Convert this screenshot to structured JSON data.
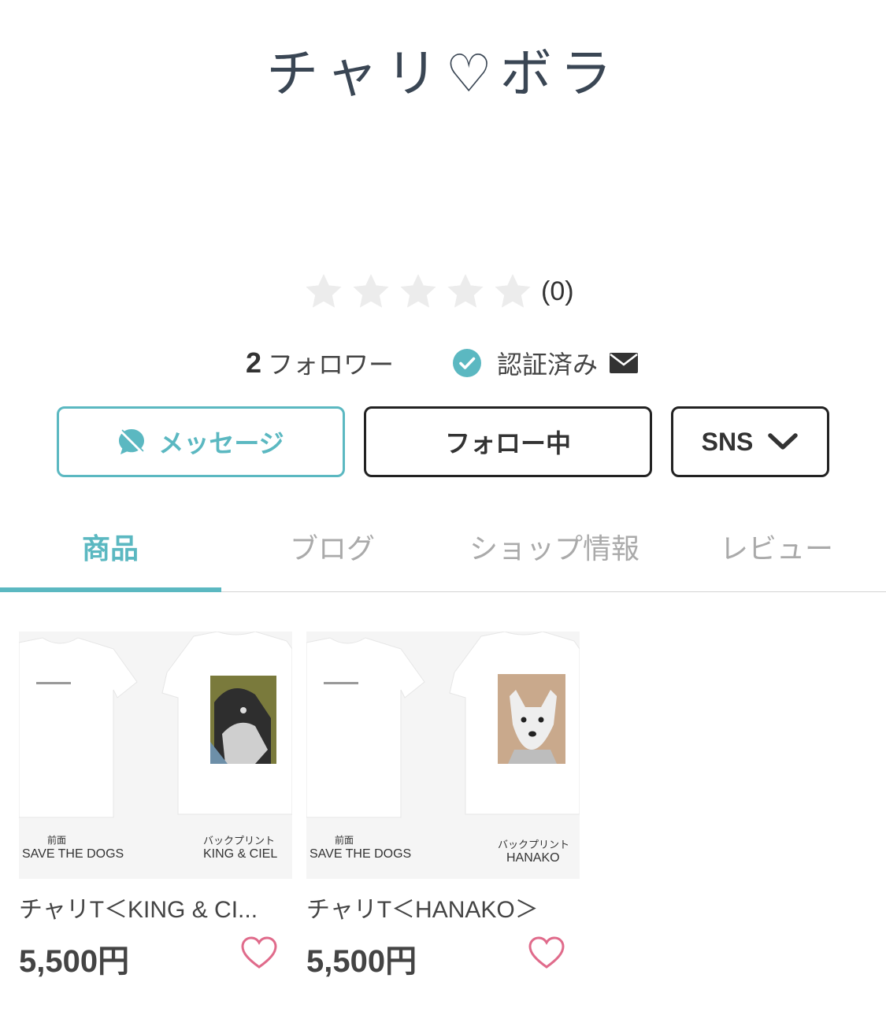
{
  "shop": {
    "name": "チャリ♡ボラ"
  },
  "rating": {
    "stars_filled": 0,
    "stars_total": 5,
    "count_label": "(0)"
  },
  "followers": {
    "count": "2",
    "label": "フォロワー"
  },
  "verification": {
    "label": "認証済み"
  },
  "buttons": {
    "message": "メッセージ",
    "follow": "フォロー中",
    "sns": "SNS"
  },
  "tabs": [
    {
      "label": "商品",
      "active": true
    },
    {
      "label": "ブログ",
      "active": false
    },
    {
      "label": "ショップ情報",
      "active": false
    },
    {
      "label": "レビュー",
      "active": false
    }
  ],
  "products": [
    {
      "name": "チャリT＜KING & CI...",
      "price": "5,500円",
      "image_text": {
        "front_caption": "前面",
        "front_title": "SAVE THE DOGS",
        "back_caption": "バックプリント",
        "back_title": "KING & CIEL"
      }
    },
    {
      "name": "チャリT＜HANAKO＞",
      "price": "5,500円",
      "image_text": {
        "front_caption": "前面",
        "front_title": "SAVE THE DOGS",
        "back_caption": "バックプリント",
        "back_title": "HANAKO"
      }
    }
  ],
  "colors": {
    "accent": "#5bb8c1",
    "heart": "#e06b8b",
    "star_empty": "#ececec"
  },
  "icons": {
    "star": "star-icon",
    "verified": "check-circle-icon",
    "mail": "mail-icon",
    "message": "chat-bubble-icon",
    "sns_dropdown": "chevron-down-icon",
    "favorite": "heart-icon"
  }
}
